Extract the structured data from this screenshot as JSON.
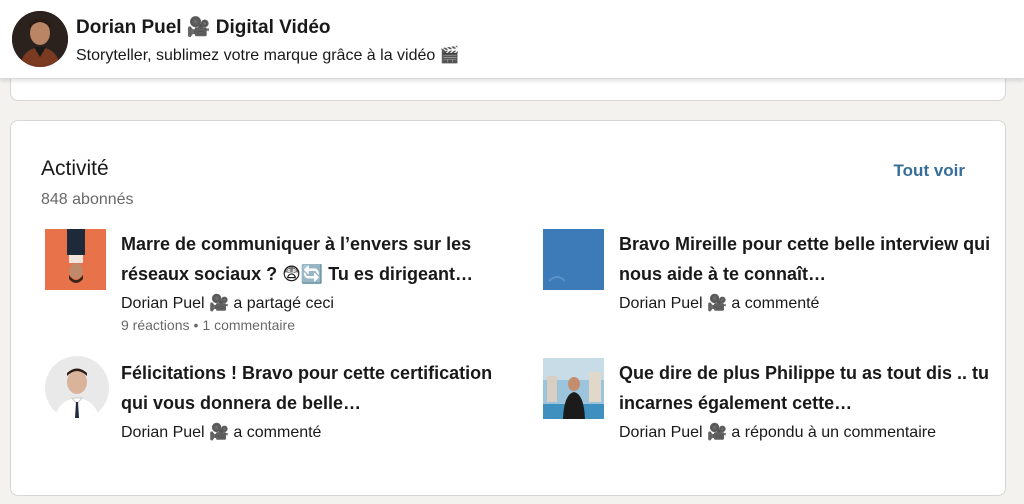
{
  "header": {
    "name": "Dorian Puel 🎥 Digital Vidéo",
    "tagline": "Storyteller, sublimez votre marque grâce à la vidéo 🎬"
  },
  "activity": {
    "title": "Activité",
    "followers": "848 abonnés",
    "see_all": "Tout voir",
    "posts": [
      {
        "title": "Marre de communiquer à l’envers sur les réseaux sociaux ? 😨🔄 Tu es dirigeant…",
        "meta": "Dorian Puel 🎥 a partagé ceci",
        "reactions": "9 réactions",
        "comments": "1 commentaire",
        "thumb_color": "#e8724a"
      },
      {
        "title": "Bravo Mireille pour cette belle interview qui nous aide à te connaît…",
        "meta": "Dorian Puel 🎥 a commenté",
        "thumb_color": "#3d7ab8"
      },
      {
        "title": "Félicitations ! Bravo pour cette certification qui vous donnera de belle…",
        "meta": "Dorian Puel 🎥 a commenté",
        "thumb_color": "#e6e6e6"
      },
      {
        "title": "Que dire de plus Philippe tu as tout dis .. tu incarnes également cette…",
        "meta": "Dorian Puel 🎥 a répondu à un commentaire",
        "thumb_color": "#7fb2cf"
      }
    ]
  }
}
